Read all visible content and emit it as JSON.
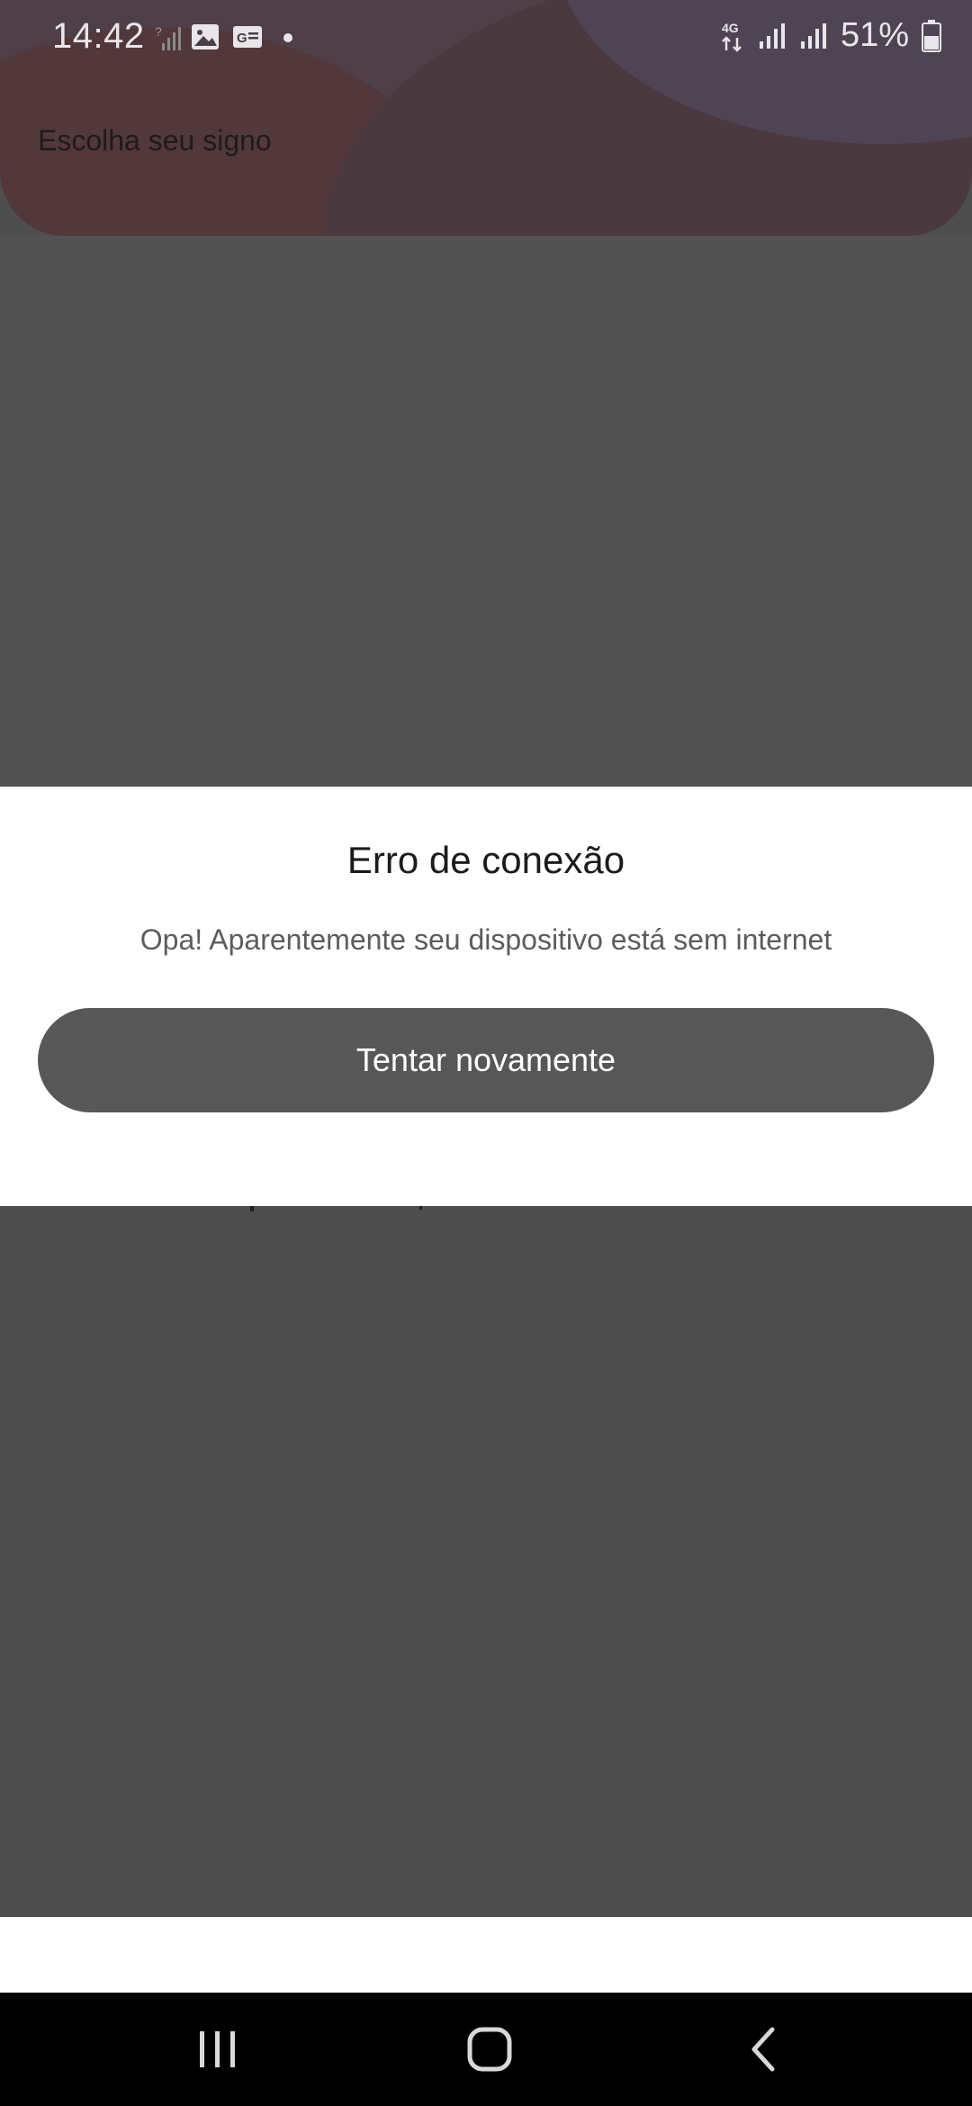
{
  "status_bar": {
    "time": "14:42",
    "network": "4G",
    "battery": "51%"
  },
  "header": {
    "title": "Escolha seu signo"
  },
  "dialog": {
    "title": "Erro de conexão",
    "message": "Opa! Aparentemente seu dispositivo está sem internet",
    "retry_label": "Tentar novamente"
  },
  "nav": {
    "recents": "recents-icon",
    "home": "home-icon",
    "back": "back-icon"
  },
  "colors": {
    "overlay": "#4e4e4e",
    "button": "#575757",
    "dialog_bg": "#ffffff"
  }
}
